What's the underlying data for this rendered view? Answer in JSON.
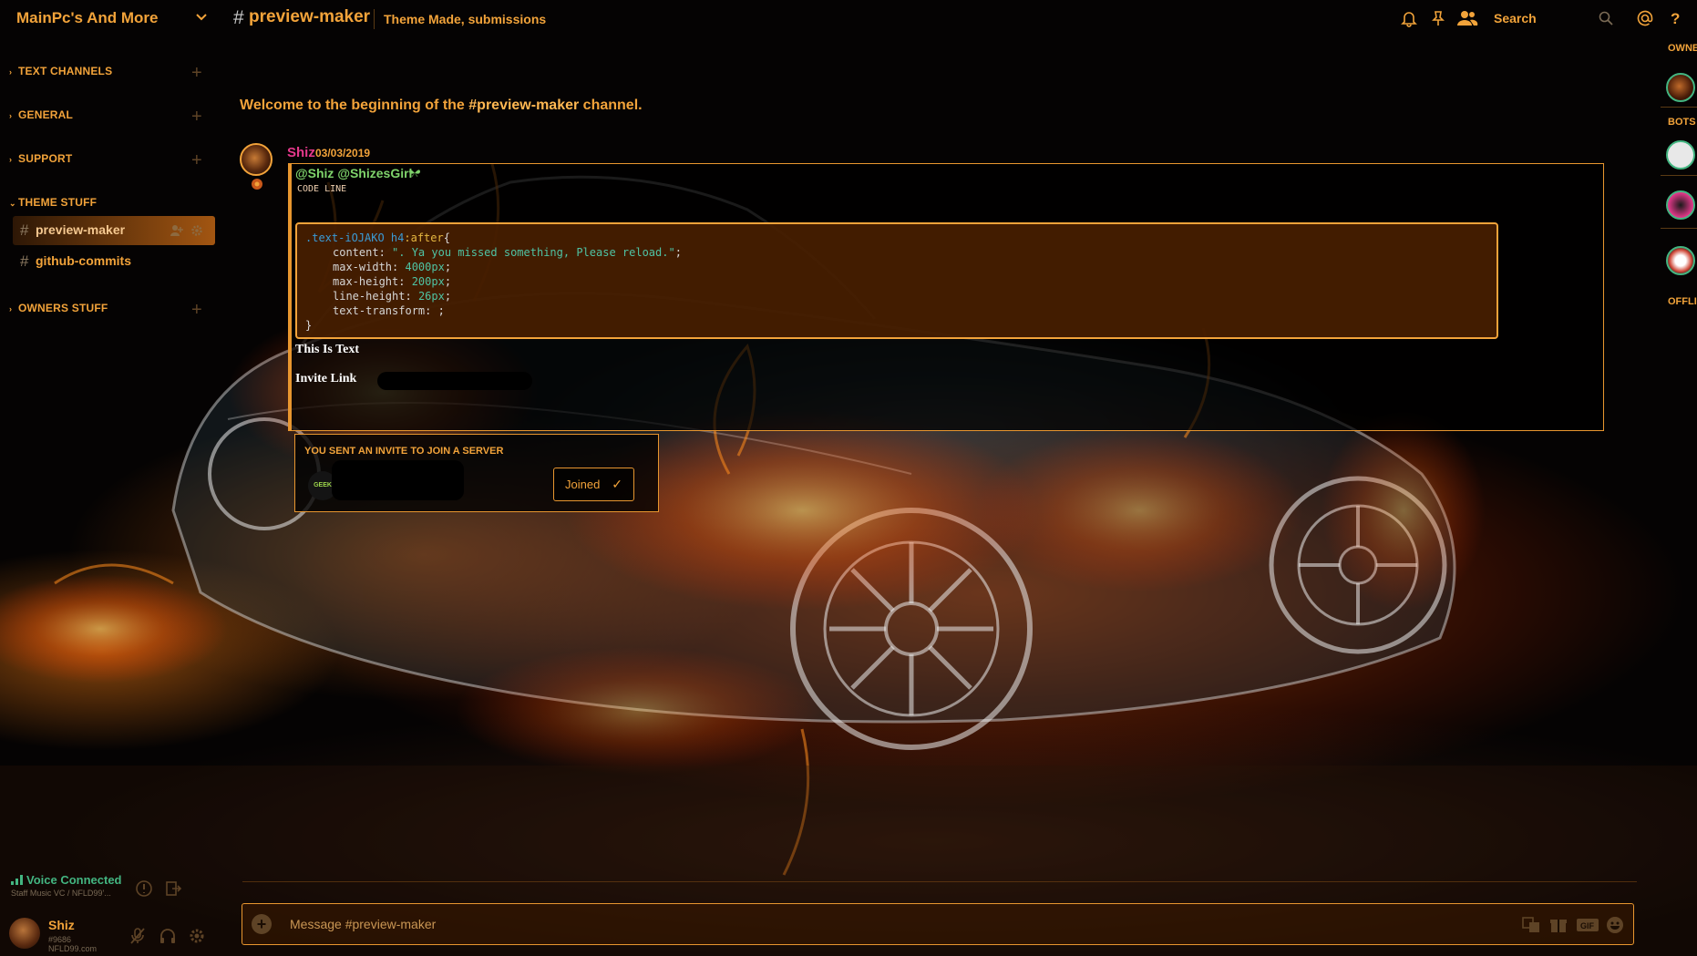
{
  "header": {
    "server_name": "MainPc's And More",
    "channel_hash": "#",
    "channel_name": "preview-maker",
    "topic": "Theme Made, submissions",
    "search_label": "Search"
  },
  "sidebar": {
    "categories": [
      {
        "label": "TEXT CHANNELS"
      },
      {
        "label": "GENERAL"
      },
      {
        "label": "SUPPORT"
      },
      {
        "label": "THEME STUFF"
      },
      {
        "label": "OWNERS STUFF"
      }
    ],
    "channels": [
      {
        "label": "preview-maker"
      },
      {
        "label": "github-commits"
      }
    ],
    "voice": {
      "status": "Voice Connected",
      "location": "Staff Music VC / NFLD99’..."
    },
    "user": {
      "name": "Shiz",
      "discriminator": "#9686",
      "subtext": "NFLD99.com"
    }
  },
  "chat": {
    "welcome_prefix": "Welcome to the beginning of the ",
    "welcome_channel": "#preview-maker",
    "welcome_suffix": " channel.",
    "message": {
      "author": "Shiz",
      "timestamp": "03/03/2019",
      "mentions": "@Shiz @ShizesGirl",
      "code_label": "CODE LINE",
      "code": {
        "selector": ".text-iOJAKO h4",
        "pseudo": ":after",
        "open": "{",
        "lines": [
          {
            "prop": "content",
            "val": "\". Ya you missed something, Please reload.\""
          },
          {
            "prop": "max-width",
            "val": "4000px"
          },
          {
            "prop": "max-height",
            "val": "200px"
          },
          {
            "prop": "line-height",
            "val": "26px"
          },
          {
            "prop": "text-transform",
            "val": ""
          }
        ],
        "close": "}"
      },
      "text_line": "This Is Text",
      "invite_line": "Invite Link"
    },
    "invite": {
      "title": "YOU SENT AN INVITE TO JOIN A SERVER",
      "server_icon_text": "GEEK",
      "button_label": "Joined",
      "button_check": "✓"
    },
    "composer": {
      "placeholder": "Message #preview-maker",
      "plus": "+"
    }
  },
  "members": {
    "sections": [
      {
        "label": "OWNER"
      },
      {
        "label": "BOTS"
      },
      {
        "label": "OFFLINE"
      }
    ]
  },
  "colors": {
    "accent": "#f2a33a",
    "mention_green": "#7fd36b",
    "author_pink": "#e6398c",
    "online_green": "#43b581"
  }
}
